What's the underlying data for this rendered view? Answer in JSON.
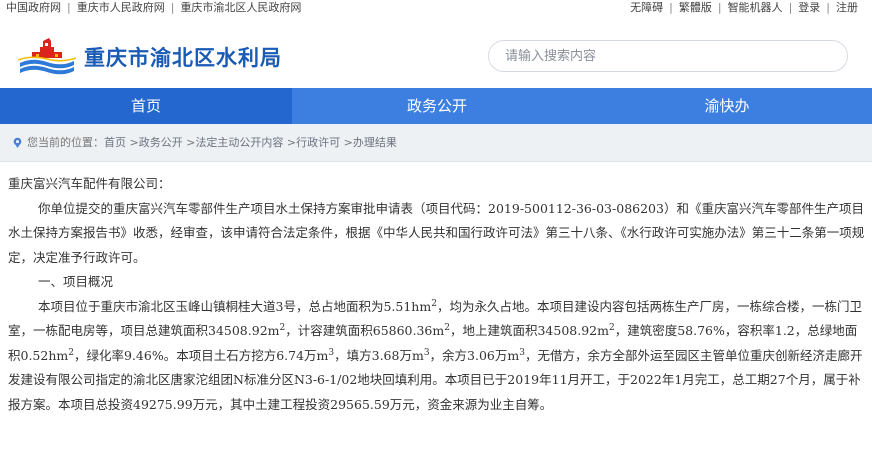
{
  "topbar": {
    "left_links": [
      "中国政府网",
      "重庆市人民政府网",
      "重庆市渝北区人民政府网"
    ],
    "right_links": [
      "无障碍",
      "繁體版",
      "智能机器人",
      "登录",
      "注册"
    ]
  },
  "header": {
    "title": "重庆市渝北区水利局",
    "search_placeholder": "请输入搜索内容"
  },
  "nav": {
    "items": [
      "首页",
      "政务公开",
      "渝快办"
    ],
    "active": "首页"
  },
  "breadcrumb": {
    "prefix": "您当前的位置：",
    "items": [
      "首页",
      "政务公开",
      "法定主动公开内容",
      "行政许可",
      "办理结果"
    ],
    "separator": " >"
  },
  "colors": {
    "brand": "#1a5bb5",
    "nav": "#3c7fe0",
    "nav_active": "#2468cf",
    "breadcrumb_bg": "#eef1f4"
  },
  "article": {
    "salutation": "重庆富兴汽车配件有限公司：",
    "para1": "你单位提交的重庆富兴汽车零部件生产项目水土保持方案审批申请表（项目代码：2019-500112-36-03-086203）和《重庆富兴汽车零部件生产项目水土保持方案报告书》收悉，经审查，该申请符合法定条件，根据《中华人民共和国行政许可法》第三十八条、《水行政许可实施办法》第三十二条第一项规定，决定准予行政许可。",
    "section1": "一、项目概况",
    "p2": {
      "s1": "本项目位于重庆市渝北区玉峰山镇桐桂大道3号，总占地面积为5.51hm",
      "s2": "，均为永久占地。本项目建设内容包括两栋生产厂房，一栋综合楼，一栋门卫室，一栋配电房等，项目总建筑面积34508.92m",
      "s3": "，计容建筑面积65860.36m",
      "s4": "，地上建筑面积34508.92m",
      "s5": "，建筑密度58.76%，容积率1.2，总绿地面积0.52hm",
      "s6": "，绿化率9.46%。本项目土石方挖方6.74万m",
      "s7": "，填方3.68万m",
      "s8": "，余方3.06万m",
      "s9": "，无借方，余方全部外运至园区主管单位重庆创新经济走廊开发建设有限公司指定的渝北区唐家沱组团N标准分区N3-6-1/02地块回填利用。本项目已于2019年11月开工，于2022年1月完工，总工期27个月，属于补报方案。本项目总投资49275.99万元，其中土建工程投资29565.59万元，资金来源为业主自筹。",
      "sq": "2",
      "cu": "3"
    }
  }
}
